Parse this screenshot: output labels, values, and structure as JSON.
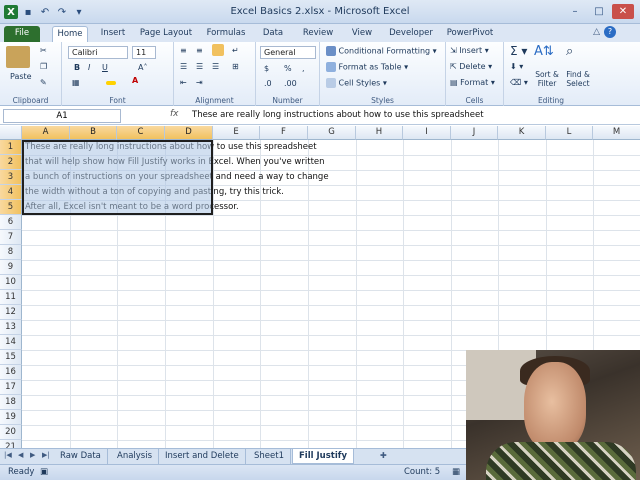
{
  "window": {
    "title": "Excel Basics 2.xlsx - Microsoft Excel"
  },
  "ribbon_tabs": [
    "File",
    "Home",
    "Insert",
    "Page Layout",
    "Formulas",
    "Data",
    "Review",
    "View",
    "Developer",
    "PowerPivot"
  ],
  "ribbon": {
    "paste": "Paste",
    "font_name": "Calibri",
    "font_size": "11",
    "number_format": "General",
    "conditional_formatting": "Conditional Formatting",
    "format_as_table": "Format as Table",
    "cell_styles": "Cell Styles",
    "insert": "Insert",
    "delete": "Delete",
    "format": "Format",
    "sort_filter": "Sort & Filter",
    "find_select": "Find & Select",
    "bold": "B",
    "italic": "I",
    "underline": "U",
    "currency": "$",
    "percent": "%",
    "groups": {
      "clipboard": "Clipboard",
      "font": "Font",
      "alignment": "Alignment",
      "number": "Number",
      "styles": "Styles",
      "cells": "Cells",
      "editing": "Editing"
    }
  },
  "formula_bar": {
    "name_box": "A1",
    "fx": "fx",
    "content": "These are really long instructions about how to use this spreadsheet"
  },
  "columns": [
    "A",
    "B",
    "C",
    "D",
    "E",
    "F",
    "G",
    "H",
    "I",
    "J",
    "K",
    "L",
    "M"
  ],
  "rows": [
    "1",
    "2",
    "3",
    "4",
    "5",
    "6",
    "7",
    "8",
    "9",
    "10",
    "11",
    "12",
    "13",
    "14",
    "15",
    "16",
    "17",
    "18",
    "19",
    "20",
    "21"
  ],
  "cells": [
    "These are really long instructions about how to use this spreadsheet",
    "that will help show how Fill Justify works in Excel.  When you've written",
    "a bunch of instructions on your spreadsheet and need a way to change",
    "the width without a ton of copying and pasting, try this trick.",
    "After all, Excel isn't meant to be a word processor."
  ],
  "sheet_tabs": [
    "Raw Data",
    "Analysis",
    "Insert and Delete",
    "Sheet1",
    "Fill Justify"
  ],
  "status": {
    "ready": "Ready",
    "count": "Count: 5"
  }
}
